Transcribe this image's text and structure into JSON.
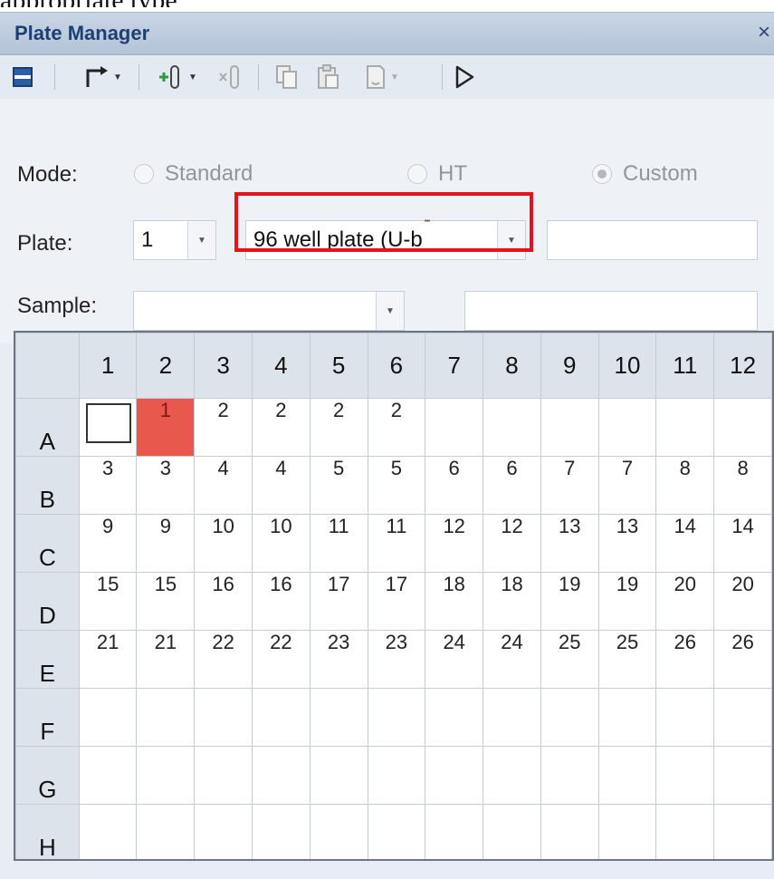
{
  "overlay": {
    "caption": "appropriate type"
  },
  "window": {
    "title": "Plate Manager",
    "close_glyph": "×"
  },
  "toolbar": {
    "icons": [
      "plate-layout-icon",
      "export-arrow-icon",
      "add-sample-icon",
      "remove-sample-icon",
      "copy-icon",
      "paste-icon",
      "clear-icon",
      "run-icon"
    ]
  },
  "mode": {
    "label": "Mode:",
    "options": [
      {
        "label": "Standard",
        "checked": false
      },
      {
        "label": "HT",
        "checked": false
      },
      {
        "label": "Custom",
        "checked": true
      }
    ]
  },
  "plate": {
    "label": "Plate:",
    "number": "1",
    "type": "96 well plate (U-b",
    "name": ""
  },
  "sample": {
    "label": "Sample:",
    "value": "",
    "separator": "-",
    "range": ""
  },
  "grid": {
    "columns": [
      "1",
      "2",
      "3",
      "4",
      "5",
      "6",
      "7",
      "8",
      "9",
      "10",
      "11",
      "12"
    ],
    "rows": [
      {
        "label": "A",
        "cells": [
          "",
          "1",
          "2",
          "2",
          "2",
          "2",
          "",
          "",
          "",
          "",
          "",
          ""
        ]
      },
      {
        "label": "B",
        "cells": [
          "3",
          "3",
          "4",
          "4",
          "5",
          "5",
          "6",
          "6",
          "7",
          "7",
          "8",
          "8"
        ]
      },
      {
        "label": "C",
        "cells": [
          "9",
          "9",
          "10",
          "10",
          "11",
          "11",
          "12",
          "12",
          "13",
          "13",
          "14",
          "14"
        ]
      },
      {
        "label": "D",
        "cells": [
          "15",
          "15",
          "16",
          "16",
          "17",
          "17",
          "18",
          "18",
          "19",
          "19",
          "20",
          "20"
        ]
      },
      {
        "label": "E",
        "cells": [
          "21",
          "21",
          "22",
          "22",
          "23",
          "23",
          "24",
          "24",
          "25",
          "25",
          "26",
          "26"
        ]
      },
      {
        "label": "F",
        "cells": [
          "",
          "",
          "",
          "",
          "",
          "",
          "",
          "",
          "",
          "",
          "",
          ""
        ]
      },
      {
        "label": "G",
        "cells": [
          "",
          "",
          "",
          "",
          "",
          "",
          "",
          "",
          "",
          "",
          "",
          ""
        ]
      },
      {
        "label": "H",
        "cells": [
          "",
          "",
          "",
          "",
          "",
          "",
          "",
          "",
          "",
          "",
          "",
          ""
        ]
      }
    ],
    "selected_cell_color": "#e8584d",
    "highlight_color": "#e8121b"
  }
}
